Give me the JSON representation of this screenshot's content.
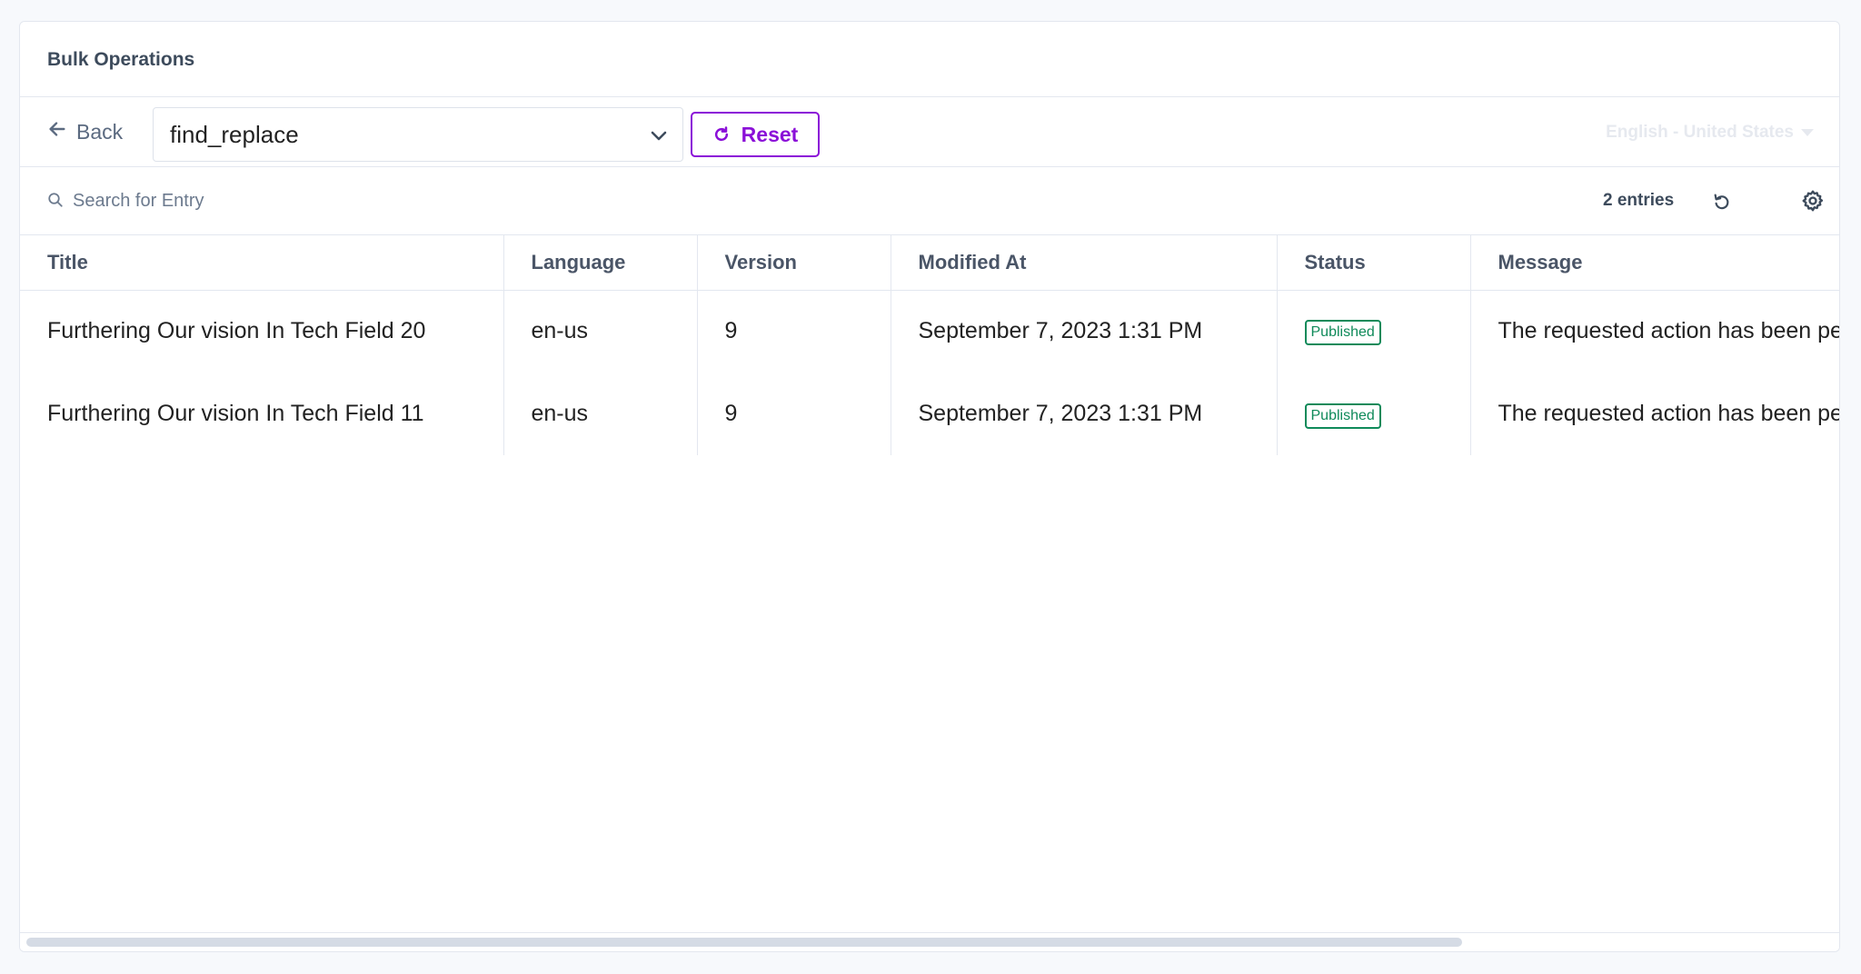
{
  "header": {
    "title": "Bulk Operations"
  },
  "toolbar": {
    "back_label": "Back",
    "operation_select_value": "find_replace",
    "reset_label": "Reset",
    "locale_label": "English - United States"
  },
  "search": {
    "placeholder": "Search for Entry",
    "entries_count": "2 entries"
  },
  "table": {
    "columns": [
      "Title",
      "Language",
      "Version",
      "Modified At",
      "Status",
      "Message"
    ],
    "rows": [
      {
        "title": "Furthering Our vision In Tech Field 20",
        "language": "en-us",
        "version": "9",
        "modified_at": "September 7, 2023 1:31 PM",
        "status": "Published",
        "message": "The requested action has been performed."
      },
      {
        "title": "Furthering Our vision In Tech Field 11",
        "language": "en-us",
        "version": "9",
        "modified_at": "September 7, 2023 1:31 PM",
        "status": "Published",
        "message": "The requested action has been performed."
      }
    ]
  },
  "colors": {
    "accent": "#8b10d8",
    "status_published": "#0f8a5a"
  }
}
